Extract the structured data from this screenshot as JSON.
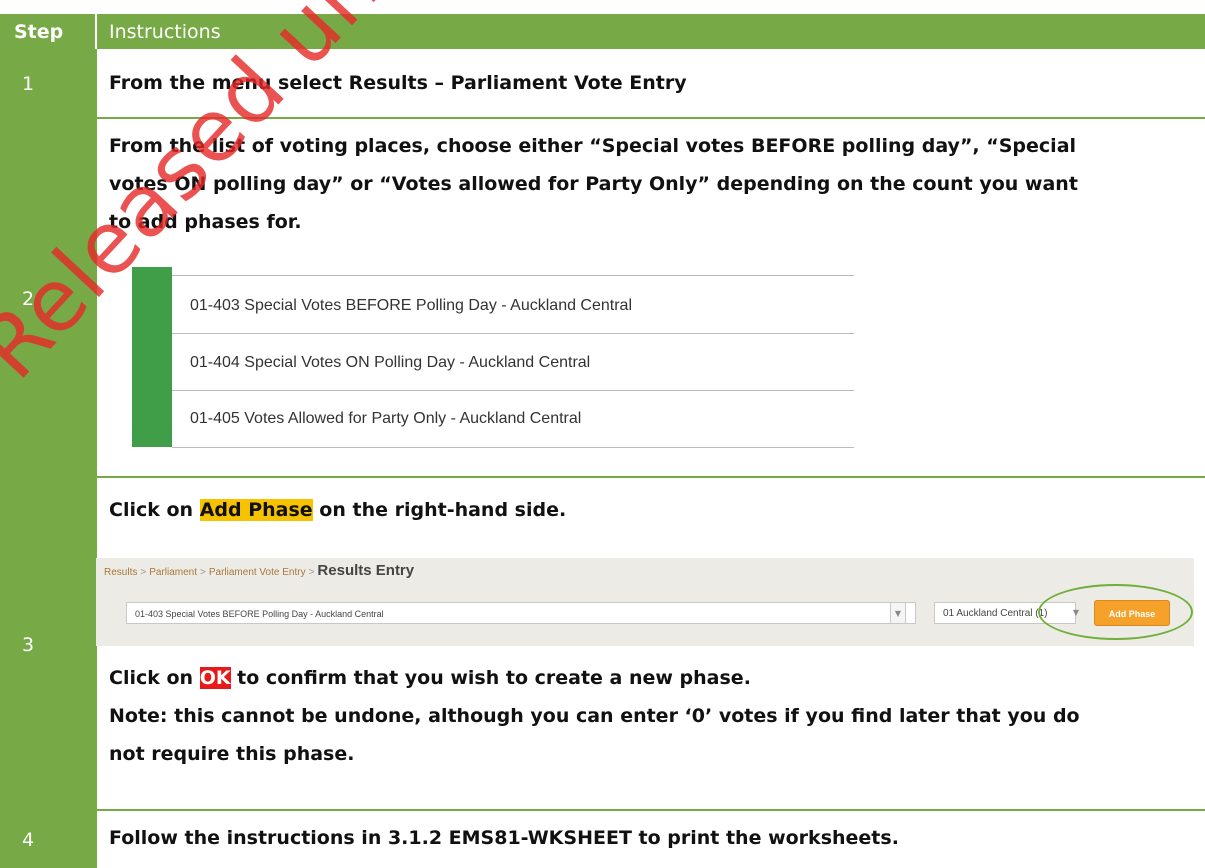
{
  "header": {
    "step": "Step",
    "instructions": "Instructions"
  },
  "rows": [
    {
      "step": "1",
      "pre": "From the menu select ",
      "bold": "Results – Parliament Vote Entry"
    },
    {
      "step": "2",
      "lines": [
        "From the list of voting places, choose either “Special votes BEFORE polling day”, “Special",
        "votes ON polling day” or “Votes allowed for Party Only” depending on the count you want",
        "to add phases for."
      ],
      "voting_places": [
        "01-403 Special Votes BEFORE Polling Day - Auckland Central",
        "01-404 Special Votes ON Polling Day - Auckland Central",
        "01-405 Votes Allowed for Party Only - Auckland Central"
      ]
    },
    {
      "step": "3",
      "line1_pre": "Click on ",
      "line1_hl": "Add Phase",
      "line1_post": " on the right-hand side.",
      "app": {
        "crumb1": "Results",
        "crumb2": "Parliament",
        "crumb3": "Parliament Vote Entry",
        "crumb_current": "Results Entry",
        "select_value": "01-403 Special Votes BEFORE Polling Day - Auckland Central",
        "electorate_value": "01 Auckland Central (1)",
        "add_phase": "Add Phase"
      },
      "line2_pre": "Click on ",
      "line2_hl": "OK",
      "line2_post": " to confirm that you wish to create a new phase.",
      "note1": "Note: this cannot be undone, although you can enter ‘0’ votes if you find later that you do",
      "note2": "not require this phase."
    },
    {
      "step": "4",
      "text": "Follow the instructions in 3.1.2 EMS81-WKSHEET to print the worksheets."
    }
  ],
  "watermark": "Released under the Official Information Act",
  "colors": {
    "header_green": "#77AA46",
    "list_bar": "#3F9E47",
    "add_phase_btn": "#F5A12A",
    "highlight_yellow": "#F7C200",
    "highlight_red": "#E81919",
    "watermark_red": "#E62828"
  }
}
